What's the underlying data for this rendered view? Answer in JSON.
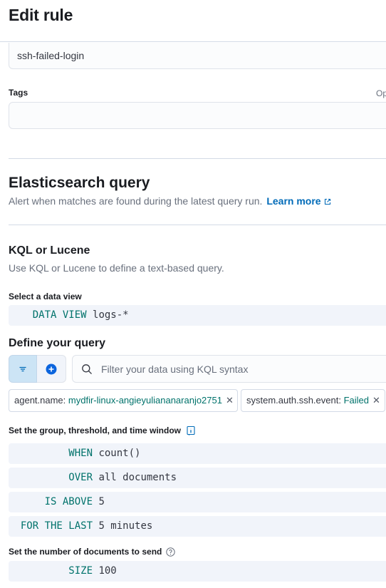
{
  "flyout": {
    "title": "Edit rule"
  },
  "rule_name": {
    "value": "ssh-failed-login"
  },
  "tags": {
    "label": "Tags",
    "optional": "Op",
    "value": ""
  },
  "es_query": {
    "title": "Elasticsearch query",
    "description": "Alert when matches are found during the latest query run.",
    "learn_more": "Learn more"
  },
  "kql": {
    "title": "KQL or Lucene",
    "description": "Use KQL or Lucene to define a text-based query."
  },
  "data_view": {
    "label": "Select a data view",
    "keyword": "DATA VIEW",
    "value": "logs-*"
  },
  "query": {
    "title": "Define your query",
    "placeholder": "Filter your data using KQL syntax",
    "filters": [
      {
        "field": "agent.name:",
        "value": "mydfir-linux-angieyuliananaranjo2751"
      },
      {
        "field": "system.auth.ssh.event:",
        "value": "Failed"
      }
    ]
  },
  "threshold": {
    "label": "Set the group, threshold, and time window",
    "when_kw": "WHEN",
    "when_val": "count()",
    "over_kw": "OVER",
    "over_val": "all documents",
    "above_kw": "IS ABOVE",
    "above_val": "5",
    "last_kw": "FOR THE LAST",
    "last_val": "5 minutes"
  },
  "size": {
    "label": "Set the number of documents to send",
    "keyword": "SIZE",
    "value": "100"
  },
  "colors": {
    "accent": "#006bb8",
    "keyword": "#00726b",
    "code_bg": "#f1f4fa",
    "border": "#d3dae6"
  }
}
